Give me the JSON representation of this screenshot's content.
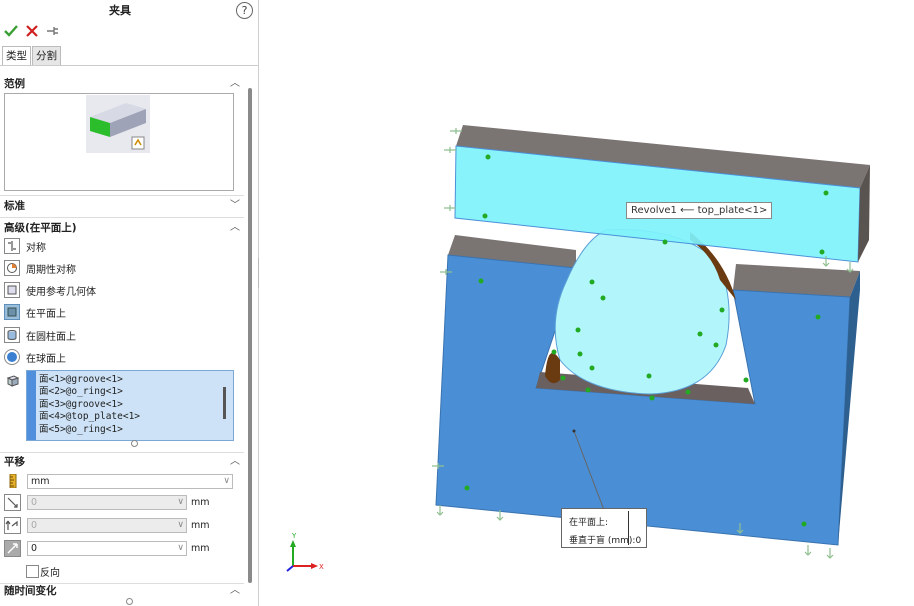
{
  "panel": {
    "title": "夹具",
    "help": "?",
    "tabs": [
      "类型",
      "分割"
    ],
    "sections": {
      "example": "范例",
      "standard": "标准",
      "advanced": "高级(在平面上)",
      "translate": "平移",
      "time_varying": "随时间变化"
    },
    "options": [
      "对称",
      "周期性对称",
      "使用参考几何体",
      "在平面上",
      "在圆柱面上",
      "在球面上"
    ],
    "faces": [
      "面<1>@groove<1>",
      "面<2>@o_ring<1>",
      "面<3>@groove<1>",
      "面<4>@top_plate<1>",
      "面<5>@o_ring<1>"
    ],
    "unit_select": "mm",
    "fields": [
      {
        "value": "0",
        "unit": "mm"
      },
      {
        "value": "0",
        "unit": "mm"
      },
      {
        "value": "0",
        "unit": "mm"
      }
    ],
    "reverse": "反向"
  },
  "viewport": {
    "tooltip": "Revolve1 ⟵ top_plate<1>",
    "callout_line1": "在平面上:",
    "callout_line2": "垂直于盲 (mm):0",
    "triad_y": "Y",
    "triad_x": "X"
  },
  "colors": {
    "cyan_plate": "#7ff2fb",
    "blue_block": "#4a8fd6",
    "fixture_dot": "#22aa22",
    "ok": "#3aa034",
    "cancel": "#d02020"
  }
}
